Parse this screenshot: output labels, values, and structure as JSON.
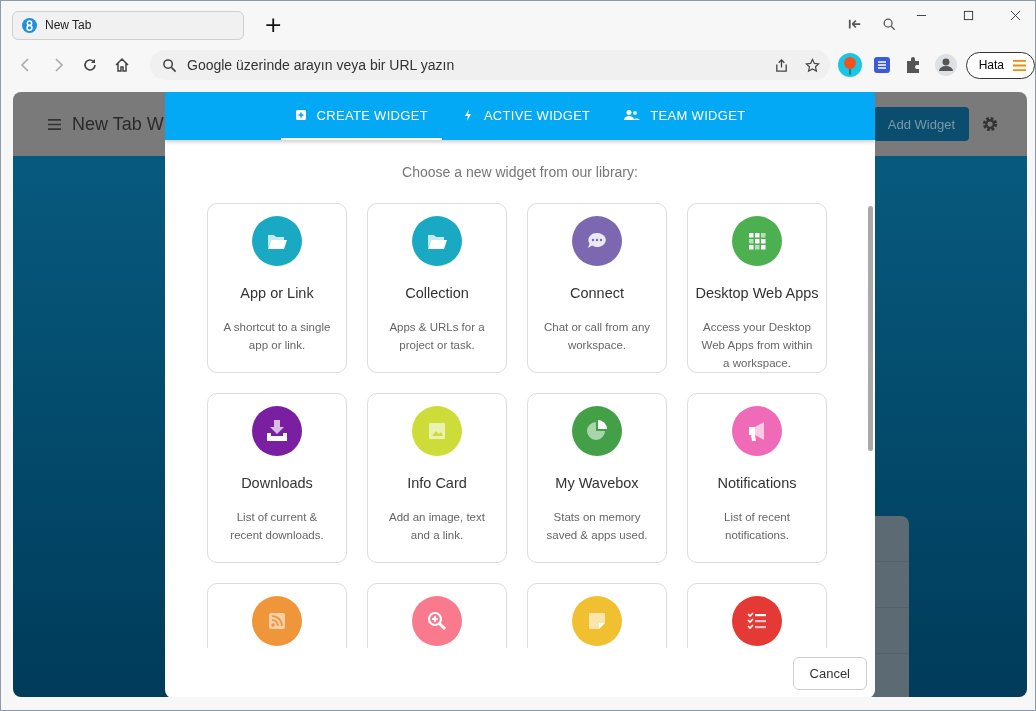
{
  "browser": {
    "tab_title": "New Tab",
    "new_tab_symbol": "+",
    "address_placeholder": "Google üzerinde arayın veya bir URL yazın",
    "profile_label": "Hata"
  },
  "page": {
    "title": "New Tab W",
    "add_button": "Add Widget"
  },
  "dialog": {
    "tabs": [
      {
        "label": "CREATE WIDGET",
        "selected": true
      },
      {
        "label": "ACTIVE WIDGET",
        "selected": false
      },
      {
        "label": "TEAM WIDGET",
        "selected": false
      }
    ],
    "prompt": "Choose a new widget from our library:",
    "widgets": [
      {
        "title": "App or Link",
        "description": "A shortcut to a single app or link.",
        "color": "#1aa9c2"
      },
      {
        "title": "Collection",
        "description": "Apps & URLs for a project or task.",
        "color": "#1aa9c2"
      },
      {
        "title": "Connect",
        "description": "Chat or call from any workspace.",
        "color": "#7b68b0"
      },
      {
        "title": "Desktop Web Apps",
        "description": "Access your Desktop Web Apps from within a workspace.",
        "color": "#4caf50"
      },
      {
        "title": "Downloads",
        "description": "List of current & recent downloads.",
        "color": "#7b1fa2"
      },
      {
        "title": "Info Card",
        "description": "Add an image, text and a link.",
        "color": "#cddc39"
      },
      {
        "title": "My Wavebox",
        "description": "Stats on memory saved & apps used.",
        "color": "#43a047"
      },
      {
        "title": "Notifications",
        "description": "List of recent notifications.",
        "color": "#f06bb7"
      },
      {
        "color": "#f0963a"
      },
      {
        "color": "#f87a8c"
      },
      {
        "color": "#f0c030"
      },
      {
        "color": "#e53935"
      }
    ],
    "cancel_button": "Cancel"
  }
}
